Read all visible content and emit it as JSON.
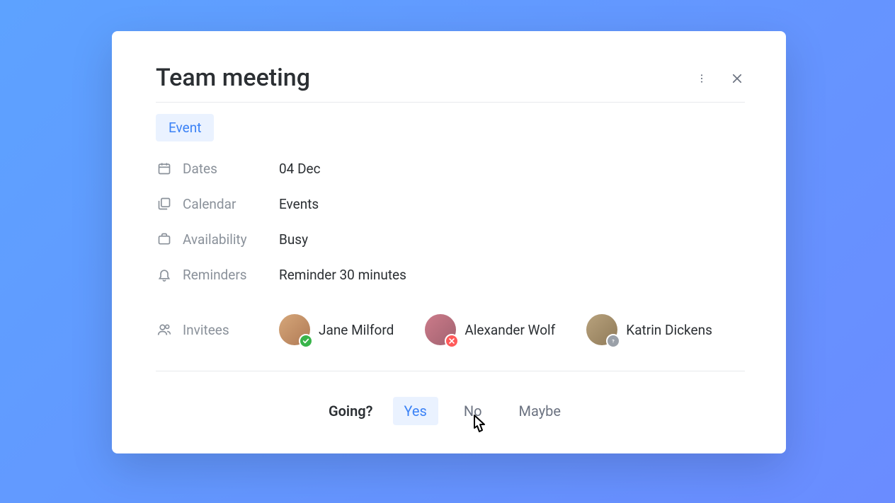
{
  "event": {
    "title": "Team meeting",
    "tab_label": "Event"
  },
  "fields": {
    "dates_label": "Dates",
    "dates_value": "04 Dec",
    "calendar_label": "Calendar",
    "calendar_value": "Events",
    "availability_label": "Availability",
    "availability_value": "Busy",
    "reminders_label": "Reminders",
    "reminders_value": "Reminder  30  minutes",
    "invitees_label": "Invitees"
  },
  "invitees": [
    {
      "name": "Jane Milford",
      "status": "accepted"
    },
    {
      "name": "Alexander Wolf",
      "status": "declined"
    },
    {
      "name": "Katrin Dickens",
      "status": "unknown"
    }
  ],
  "footer": {
    "going_label": "Going?",
    "answers": {
      "yes": "Yes",
      "no": "No",
      "maybe": "Maybe"
    }
  }
}
